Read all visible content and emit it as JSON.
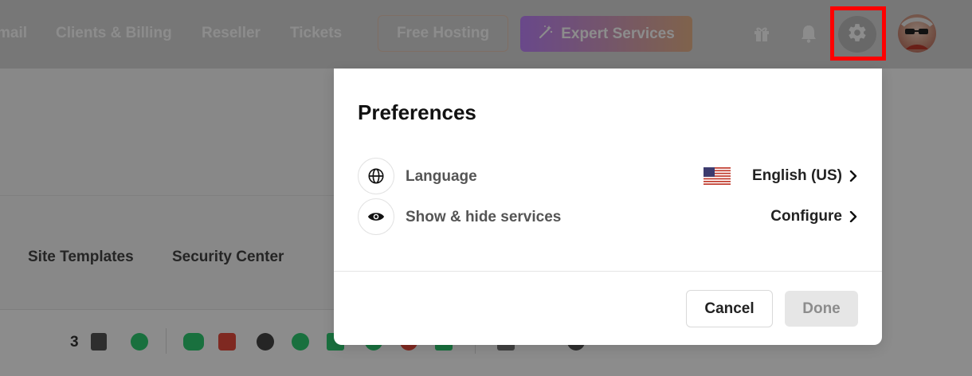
{
  "topbar": {
    "nav": [
      "mail",
      "Clients & Billing",
      "Reseller",
      "Tickets"
    ],
    "free_hosting_label": "Free Hosting",
    "expert_services_label": "Expert Services"
  },
  "background": {
    "tabs": [
      "Site Templates",
      "Security Center"
    ],
    "toolbar_count": "3"
  },
  "preferences": {
    "title": "Preferences",
    "language_label": "Language",
    "language_value": "English (US)",
    "services_label": "Show & hide services",
    "services_value": "Configure",
    "cancel_label": "Cancel",
    "done_label": "Done"
  },
  "icons": {
    "gift": "gift-icon",
    "bell": "bell-icon",
    "gear": "gear-icon",
    "globe": "globe-icon",
    "eye": "eye-icon",
    "chevron": "chevron-right-icon",
    "flag": "us-flag-icon"
  },
  "colors": {
    "highlight": "#ff0000",
    "expert_gradient_start": "#c084fc",
    "expert_gradient_end": "#e8b48a"
  }
}
